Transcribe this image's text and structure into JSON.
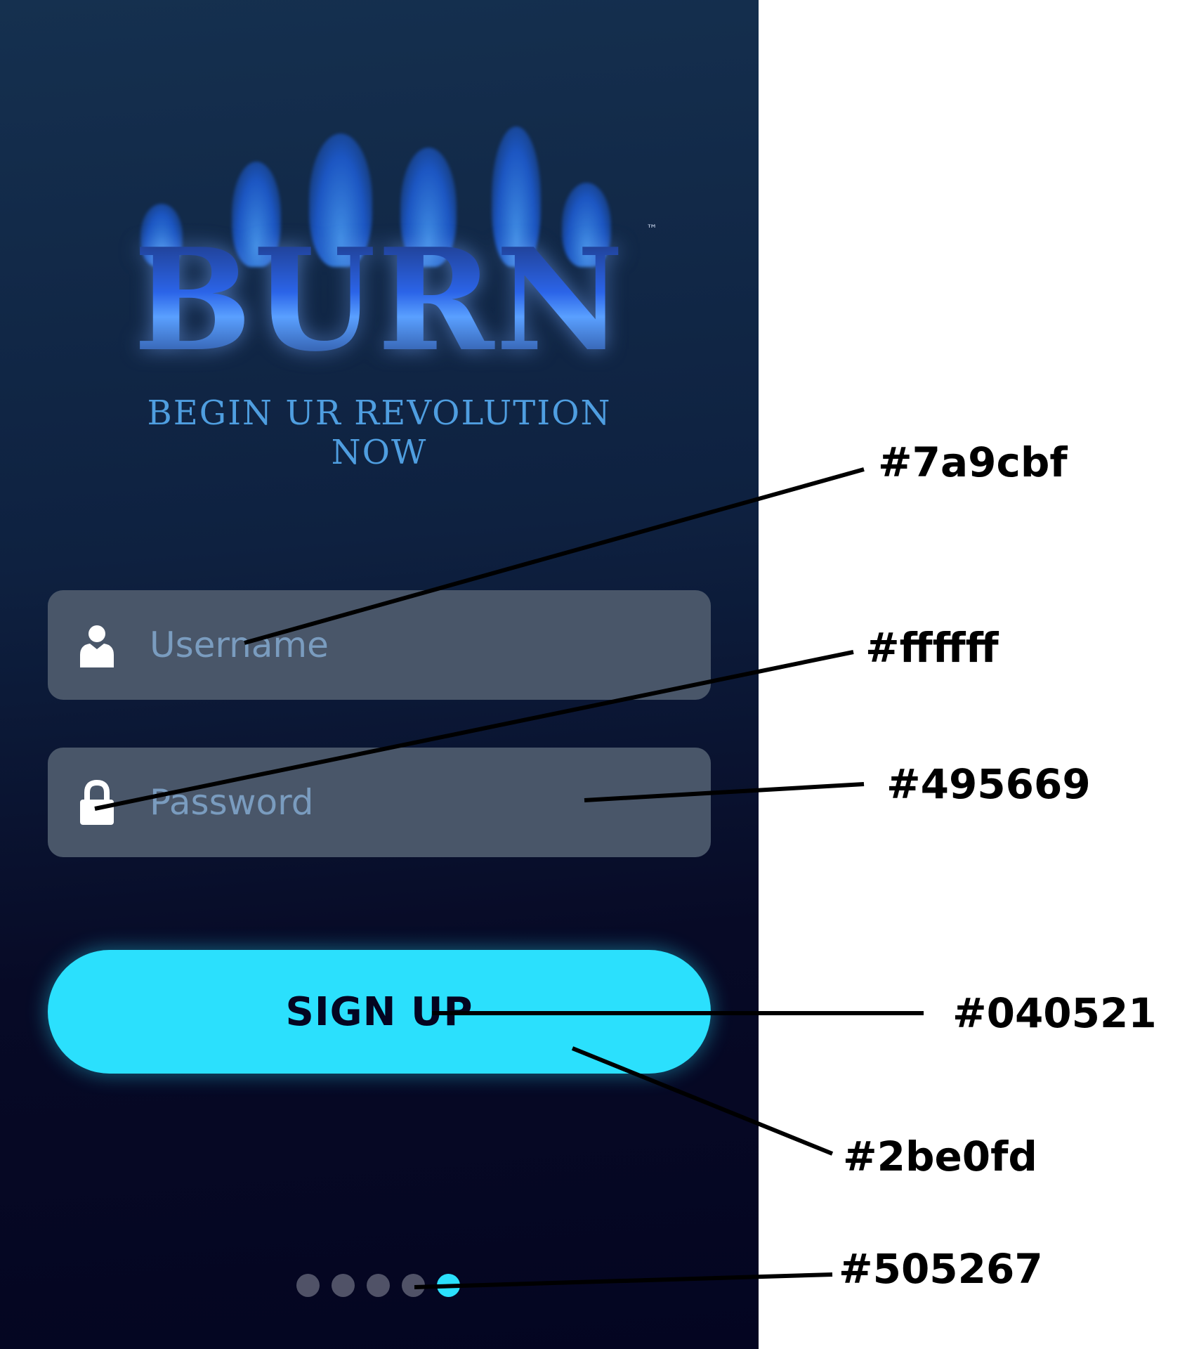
{
  "logo": {
    "text": "BURN",
    "tm": "™"
  },
  "tagline": "BEGIN UR REVOLUTION NOW",
  "username": {
    "placeholder": "Username",
    "icon": "user-icon"
  },
  "password": {
    "placeholder": "Password",
    "icon": "lock-icon"
  },
  "signup": {
    "label": "SIGN UP"
  },
  "pager": {
    "count": 5,
    "active_index": 4
  },
  "annotations": [
    {
      "label": "#7a9cbf"
    },
    {
      "label": "#ffffff"
    },
    {
      "label": "#495669"
    },
    {
      "label": "#040521"
    },
    {
      "label": "#2be0fd"
    },
    {
      "label": "#505267"
    }
  ],
  "colors": {
    "placeholder_text": "#7a9cbf",
    "icon": "#ffffff",
    "field_bg": "#495669",
    "button_text": "#040521",
    "button_bg": "#2be0fd",
    "dot_inactive": "#505267"
  }
}
